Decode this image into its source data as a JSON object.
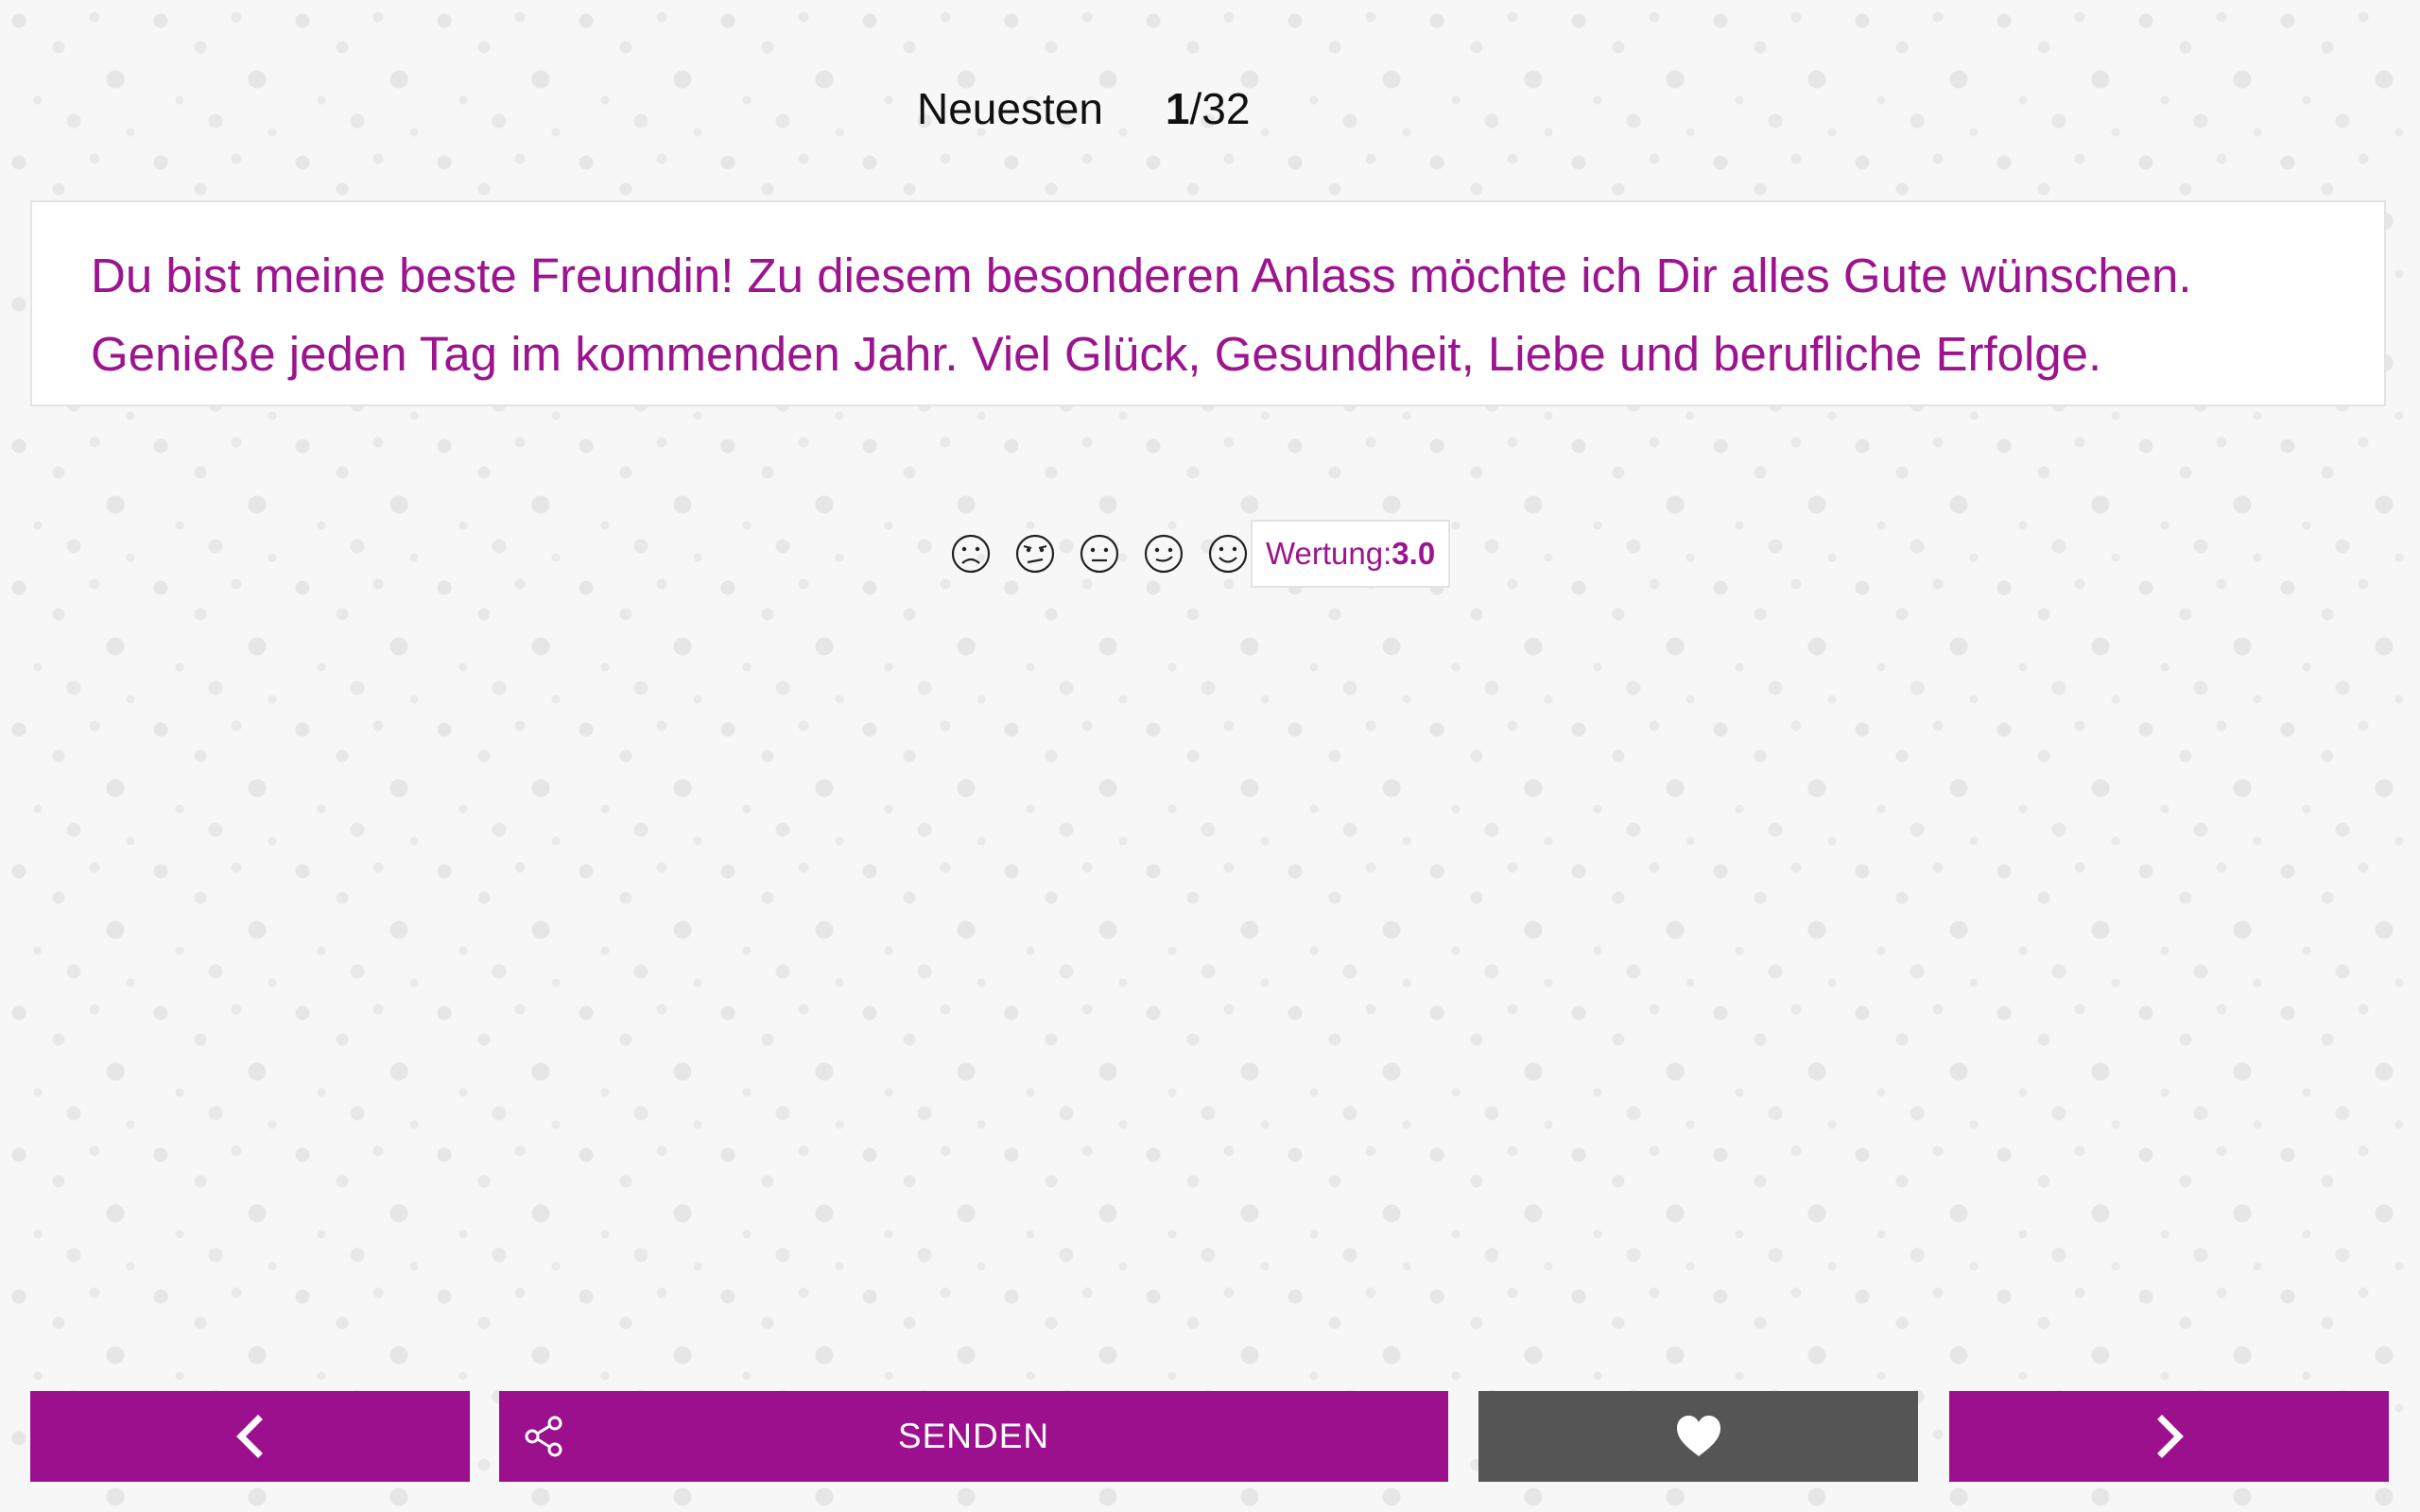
{
  "header": {
    "sort_label": "Neuesten",
    "counter_current": "1",
    "counter_total": "/32"
  },
  "message": {
    "text_line1": "Du bist meine beste Freundin! Zu diesem besonderen Anlass möchte ich Dir alles Gute wünschen.",
    "text_line2": "Genieße jeden Tag im kommenden Jahr. Viel Glück, Gesundheit, Liebe und berufliche Erfolge."
  },
  "rating": {
    "faces": [
      "very-sad-face-icon",
      "sad-face-icon",
      "neutral-face-icon",
      "happy-face-icon",
      "very-happy-face-icon"
    ],
    "label": "Wertung:",
    "value": "3.0"
  },
  "toolbar": {
    "prev_icon": "chevron-left-icon",
    "share_icon": "share-icon",
    "send_label": "SENDEN",
    "favorite_icon": "heart-icon",
    "next_icon": "chevron-right-icon"
  },
  "colors": {
    "accent": "#9c108e",
    "text_accent": "#9c148e",
    "favorite_button": "#555555",
    "background": "#f7f7f7"
  }
}
